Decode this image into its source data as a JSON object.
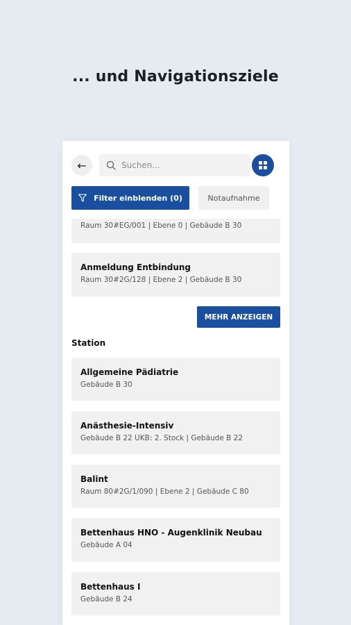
{
  "headline": "... und Navigationsziele",
  "search": {
    "placeholder": "Suchen..."
  },
  "filter": {
    "label": "Filter einblenden (0)"
  },
  "chip": {
    "label": "Notaufnahme"
  },
  "top_results": [
    {
      "title": "",
      "sub": "Raum 30#EG/001 | Ebene 0 | Gebäude B 30"
    },
    {
      "title": "Anmeldung Entbindung",
      "sub": "Raum 30#2G/128 | Ebene 2 | Gebäude B 30"
    }
  ],
  "more_button": "MEHR ANZEIGEN",
  "station": {
    "heading": "Station",
    "items": [
      {
        "title": "Allgemeine Pädiatrie",
        "sub": "Gebäude B 30"
      },
      {
        "title": "Anästhesie-Intensiv",
        "sub": "Gebäude B 22 UKB: 2. Stock | Gebäude B 22"
      },
      {
        "title": "Balint",
        "sub": "Raum 80#2G/1/090 | Ebene 2 | Gebäude C 80"
      },
      {
        "title": "Bettenhaus HNO - Augenklinik Neubau",
        "sub": "Gebäude A 04"
      },
      {
        "title": "Bettenhaus I",
        "sub": "Gebäude B 24"
      }
    ]
  },
  "colors": {
    "primary": "#1a4fa0",
    "background": "#e6ebf2",
    "card": "#f1f1f1"
  }
}
